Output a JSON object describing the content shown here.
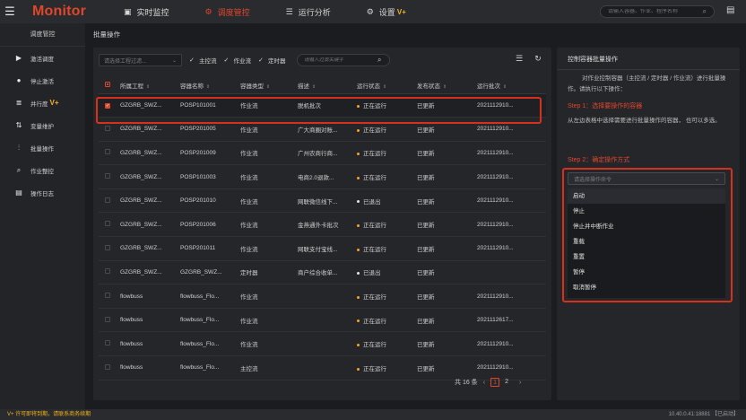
{
  "app": {
    "brand": "Monitor"
  },
  "topnav": [
    {
      "icon": "▣",
      "label": "实时监控"
    },
    {
      "icon": "⚙",
      "label": "调度管控"
    },
    {
      "icon": "☰",
      "label": "运行分析"
    },
    {
      "icon": "⚙",
      "label": "设置",
      "badge": "V+"
    }
  ],
  "global_search": {
    "placeholder": "请输入容器、作业、程序名称"
  },
  "sidebar": {
    "title": "调度管控",
    "items": [
      {
        "icon": "▶",
        "label": "激活调度"
      },
      {
        "icon": "●",
        "label": "停止激活"
      },
      {
        "icon": "≣",
        "label": "并行度",
        "badge": "V+"
      },
      {
        "icon": "⇅",
        "label": "变量维护"
      },
      {
        "icon": "⫶",
        "label": "批量操作"
      },
      {
        "icon": "⌕",
        "label": "作业整控"
      },
      {
        "icon": "▤",
        "label": "操作日志"
      }
    ]
  },
  "breadcrumb": "批量操作",
  "filters": {
    "project_placeholder": "请选择工程过滤...",
    "checks": [
      "主控流",
      "作业流",
      "定时器"
    ],
    "search_placeholder": "请输入过滤关键字"
  },
  "table": {
    "columns": [
      "所属工程",
      "容器名称",
      "容器类型",
      "描述",
      "运行状态",
      "发布状态",
      "运行批次"
    ],
    "rows": [
      {
        "checked": true,
        "project": "GZGRB_SWZ...",
        "name": "POSP101001",
        "type": "作业流",
        "desc": "脱机批次",
        "status": "正在运行",
        "status_color": "#f5a623",
        "publish": "已更新",
        "batch": "2021112910..."
      },
      {
        "checked": false,
        "project": "GZGRB_SWZ...",
        "name": "POSP201005",
        "type": "作业流",
        "desc": "广大商圈对账...",
        "status": "正在运行",
        "status_color": "#f5a623",
        "publish": "已更新",
        "batch": "2021112910..."
      },
      {
        "checked": false,
        "project": "GZGRB_SWZ...",
        "name": "POSP201009",
        "type": "作业流",
        "desc": "广州农商行商...",
        "status": "正在运行",
        "status_color": "#f5a623",
        "publish": "已更新",
        "batch": "2021112910..."
      },
      {
        "checked": false,
        "project": "GZGRB_SWZ...",
        "name": "POSP101003",
        "type": "作业流",
        "desc": "电商2.0退款...",
        "status": "正在运行",
        "status_color": "#f5a623",
        "publish": "已更新",
        "batch": "2021112910..."
      },
      {
        "checked": false,
        "project": "GZGRB_SWZ...",
        "name": "POSP201010",
        "type": "作业流",
        "desc": "网联微信线下...",
        "status": "已退出",
        "status_color": "#e6e6e6",
        "publish": "已更新",
        "batch": "2021112910..."
      },
      {
        "checked": false,
        "project": "GZGRB_SWZ...",
        "name": "POSP201006",
        "type": "作业流",
        "desc": "金燕通外卡批次",
        "status": "正在运行",
        "status_color": "#f5a623",
        "publish": "已更新",
        "batch": "2021112910..."
      },
      {
        "checked": false,
        "project": "GZGRB_SWZ...",
        "name": "POSP201011",
        "type": "作业流",
        "desc": "网联支付宝线...",
        "status": "正在运行",
        "status_color": "#f5a623",
        "publish": "已更新",
        "batch": "2021112910..."
      },
      {
        "checked": false,
        "project": "GZGRB_SWZ...",
        "name": "GZGRB_SWZ...",
        "type": "定时器",
        "desc": "商户综合收单...",
        "status": "已退出",
        "status_color": "#e6e6e6",
        "publish": "已更新",
        "batch": ""
      },
      {
        "checked": false,
        "project": "flowbuss",
        "name": "flowbuss_Flo...",
        "type": "作业流",
        "desc": "",
        "status": "正在运行",
        "status_color": "#f5a623",
        "publish": "已更新",
        "batch": "2021112910..."
      },
      {
        "checked": false,
        "project": "flowbuss",
        "name": "flowbuss_Flo...",
        "type": "作业流",
        "desc": "",
        "status": "正在运行",
        "status_color": "#f5a623",
        "publish": "已更新",
        "batch": "2021112617..."
      },
      {
        "checked": false,
        "project": "flowbuss",
        "name": "flowbuss_Flo...",
        "type": "作业流",
        "desc": "",
        "status": "正在运行",
        "status_color": "#f5a623",
        "publish": "已更新",
        "batch": "2021112910..."
      },
      {
        "checked": false,
        "project": "flowbuss",
        "name": "flowbuss_Flo...",
        "type": "主控流",
        "desc": "",
        "status": "正在运行",
        "status_color": "#f5a623",
        "publish": "已更新",
        "batch": "2021112910..."
      }
    ]
  },
  "pagination": {
    "total": "共 16 条",
    "pages": [
      "1",
      "2"
    ],
    "current": "1"
  },
  "right_panel": {
    "title": "控制容器批量操作",
    "desc": "对作业控制容器（主控流 / 定时器 / 作业流）进行批量操作。请执行以下操作：",
    "step1_title": "Step 1：选择要操作的容器",
    "step1_desc": "从左边表格中选择需要进行批量操作的容器，  也可以多选。",
    "step2_title": "Step 2：确定操作方式",
    "select_placeholder": "请选择操作命令",
    "commands": [
      "启动",
      "停止",
      "停止并中断作业",
      "重载",
      "重置",
      "暂停",
      "取消暂停"
    ]
  },
  "footer": {
    "left": "V+ 许可即将到期，请联系商务续期",
    "right": "10.40.0.41:18881 【已启动】"
  },
  "colors": {
    "accent": "#e0462b",
    "running": "#f5a623",
    "vplus": "#f2b21b"
  }
}
